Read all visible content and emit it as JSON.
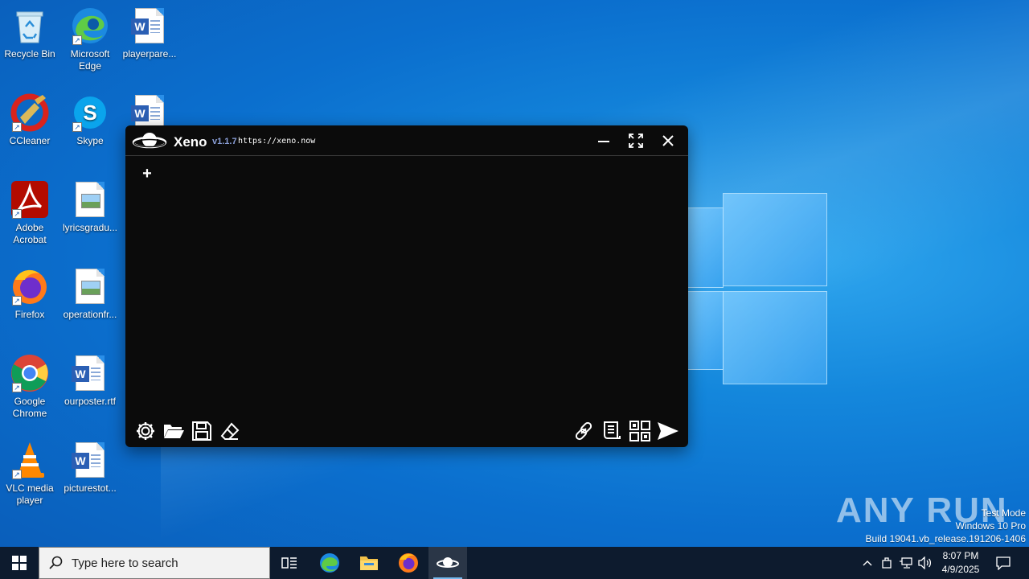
{
  "desktop": {
    "icons": [
      {
        "label": "Recycle Bin"
      },
      {
        "label": "Microsoft Edge"
      },
      {
        "label": "playerpare..."
      },
      {
        "label": "CCleaner"
      },
      {
        "label": "Skype"
      },
      {
        "label": "Adobe Acrobat"
      },
      {
        "label": "lyricsgradu..."
      },
      {
        "label": "Firefox"
      },
      {
        "label": "operationfr..."
      },
      {
        "label": "Google Chrome"
      },
      {
        "label": "ourposter.rtf"
      },
      {
        "label": "VLC media player"
      },
      {
        "label": "picturestot..."
      }
    ]
  },
  "xeno": {
    "name": "Xeno",
    "version": "v1.1.7",
    "url": "https://xeno.now",
    "add_tab": "+",
    "icons": {
      "logo": "saturn-logo-icon",
      "minimize": "minimize-icon",
      "maximize": "maximize-icon",
      "close": "close-icon",
      "settings": "gear-icon",
      "open": "folder-icon",
      "save": "floppy-disk-icon",
      "clear": "eraser-icon",
      "attach": "link-icon",
      "script_hub": "scroll-icon",
      "clients": "grid-icon",
      "execute": "send-icon"
    }
  },
  "taskbar": {
    "search_placeholder": "Type here to search",
    "time": "8:07 PM",
    "date": "4/9/2025",
    "apps": [
      "task-view-icon",
      "edge-icon",
      "file-explorer-icon",
      "firefox-icon",
      "xeno-icon"
    ]
  },
  "watermark": {
    "brand": "ANY RUN",
    "line1": "Test Mode",
    "line2": "Windows 10 Pro",
    "line3": "Build 19041.vb_release.191206-1406"
  },
  "colors": {
    "accent_version": "#8a9fd8",
    "window_bg": "#0b0b0b",
    "taskbar_bg": "#0d1b2e"
  }
}
